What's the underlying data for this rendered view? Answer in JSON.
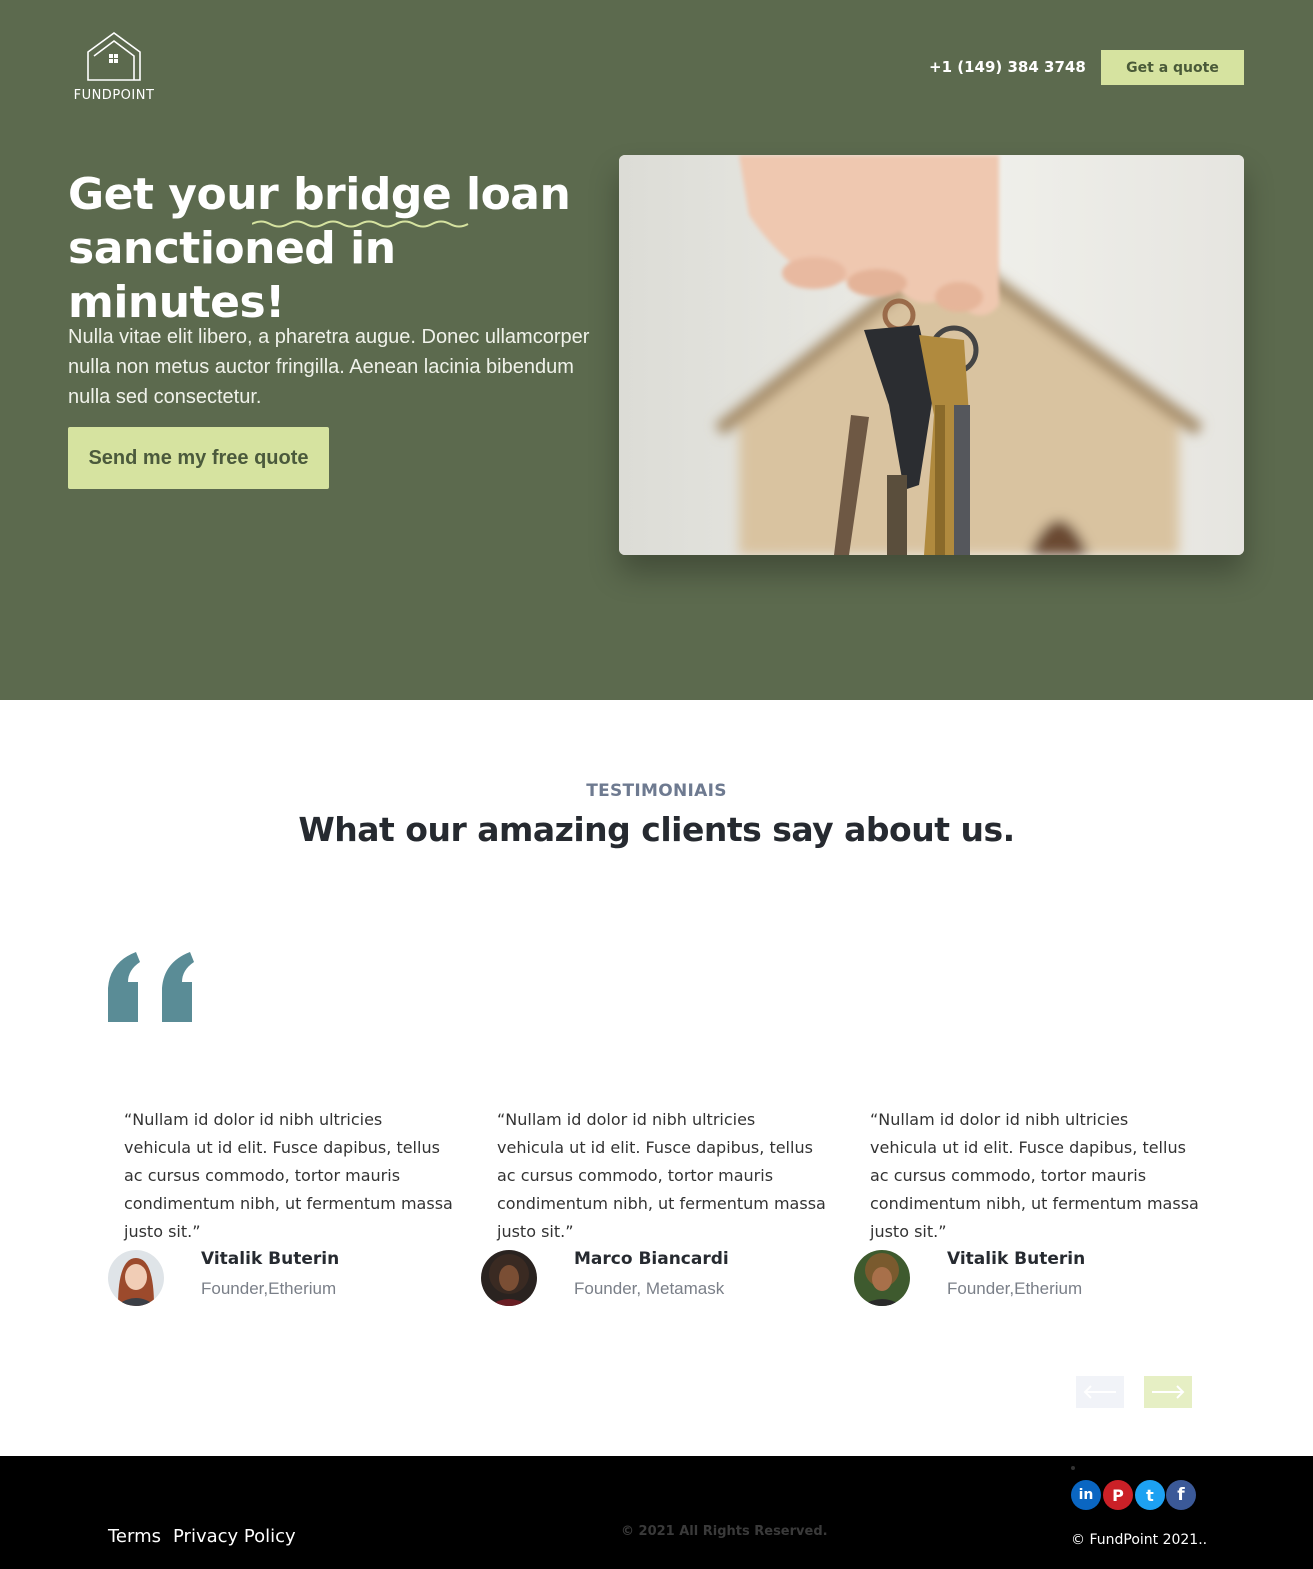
{
  "header": {
    "logo_text": "FUNDPOINT",
    "phone": "+1 (149) 384 3748",
    "quote_button": "Get a quote"
  },
  "hero": {
    "title_line1_prefix": "Get your ",
    "title_line1_highlight": "bridge loan",
    "title_line2": "sanctioned in minutes!",
    "description": "Nulla vitae elit libero, a pharetra augue. Donec ullamcorper nulla non metus auctor fringilla. Aenean lacinia bibendum nulla sed consectetur.",
    "cta_button": "Send me my free quote",
    "image_icon": "house-keys-photo"
  },
  "testimonials": {
    "eyebrow": "TESTIMONIAIS",
    "title": "What our amazing clients say about us.",
    "items": [
      {
        "quote": "“Nullam id dolor id nibh ultricies vehicula ut id elit. Fusce dapibus, tellus ac cursus commodo, tortor mauris condimentum nibh, ut fermentum massa justo sit.”",
        "name": "Vitalik Buterin",
        "role": "Founder,Etherium"
      },
      {
        "quote": "“Nullam id dolor id nibh ultricies vehicula ut id elit. Fusce dapibus, tellus ac cursus commodo, tortor mauris condimentum nibh, ut fermentum massa justo sit.”",
        "name": "Marco Biancardi",
        "role": "Founder, Metamask"
      },
      {
        "quote": "“Nullam id dolor id nibh ultricies vehicula ut id elit. Fusce dapibus, tellus ac cursus commodo, tortor mauris condimentum nibh, ut fermentum massa justo sit.”",
        "name": "Vitalik Buterin",
        "role": "Founder,Etherium"
      }
    ]
  },
  "footer": {
    "terms": "Terms",
    "privacy": "Privacy Policy",
    "rights": "© 2021 All Rights Reserved.",
    "copyright": "© FundPoint 2021..",
    "social": [
      {
        "icon": "linkedin-icon",
        "glyph": "in",
        "color": "#0a66c2"
      },
      {
        "icon": "pinterest-icon",
        "glyph": "P",
        "color": "#cb2027"
      },
      {
        "icon": "twitter-icon",
        "glyph": "t",
        "color": "#1da1f2"
      },
      {
        "icon": "facebook-icon",
        "glyph": "f",
        "color": "#3b5998"
      }
    ]
  },
  "colors": {
    "hero_bg": "#5c6a4e",
    "accent": "#d6e3a0",
    "quote_mark": "#5a8c96",
    "footer_bg": "#000000"
  }
}
